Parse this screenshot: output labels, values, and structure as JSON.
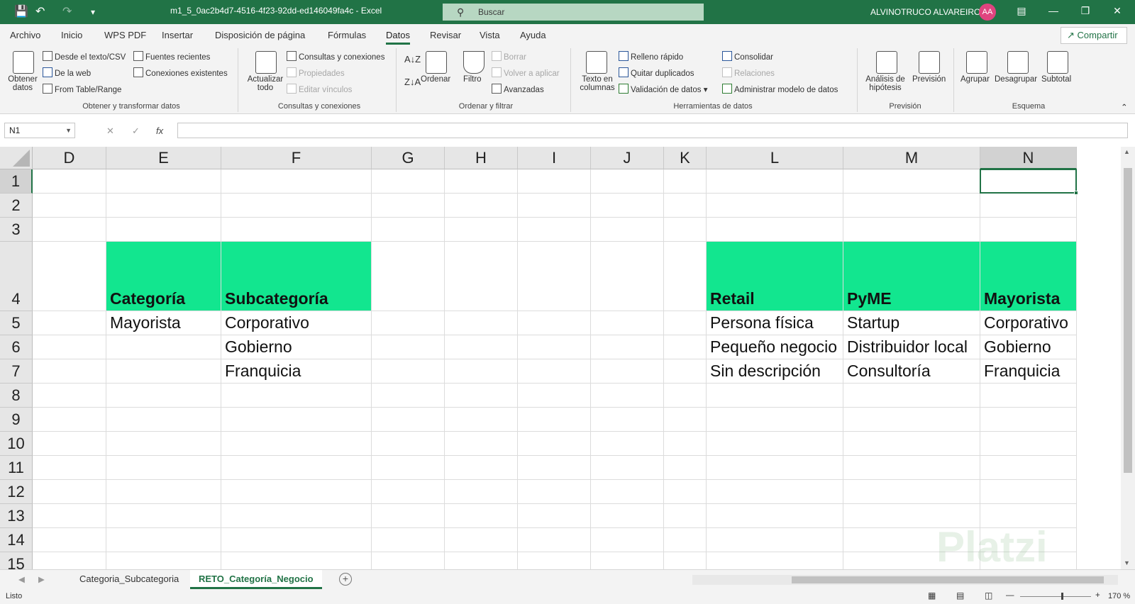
{
  "titlebar": {
    "doc_title": "m1_5_0ac2b4d7-4516-4f23-92dd-ed146049fa4c  -  Excel",
    "search_placeholder": "Buscar",
    "user_name": "ALVINOTRUCO ALVAREIRO",
    "avatar_initials": "AA"
  },
  "tabs": [
    "Archivo",
    "Inicio",
    "WPS PDF",
    "Insertar",
    "Disposición de página",
    "Fórmulas",
    "Datos",
    "Revisar",
    "Vista",
    "Ayuda"
  ],
  "active_tab": "Datos",
  "share_label": "Compartir",
  "ribbon": {
    "get_data": "Obtener datos",
    "from_text": "Desde el texto/CSV",
    "from_web": "De la web",
    "from_table": "From Table/Range",
    "recent_sources": "Fuentes recientes",
    "existing_connections": "Conexiones existentes",
    "group1": "Obtener y transformar datos",
    "refresh_all": "Actualizar todo",
    "queries_connections": "Consultas y conexiones",
    "properties": "Propiedades",
    "edit_links": "Editar vínculos",
    "group2": "Consultas y conexiones",
    "sort": "Ordenar",
    "filter": "Filtro",
    "clear": "Borrar",
    "reapply": "Volver a aplicar",
    "advanced": "Avanzadas",
    "group3": "Ordenar y filtrar",
    "text_to_columns": "Texto en columnas",
    "flash_fill": "Relleno rápido",
    "remove_duplicates": "Quitar duplicados",
    "data_validation": "Validación de datos",
    "consolidate": "Consolidar",
    "relationships": "Relaciones",
    "manage_data_model": "Administrar modelo de datos",
    "group4": "Herramientas de datos",
    "what_if": "Análisis de hipótesis",
    "forecast_sheet": "Previsión",
    "group5": "Previsión",
    "group_btn": "Agrupar",
    "ungroup": "Desagrupar",
    "subtotal": "Subtotal",
    "group6": "Esquema"
  },
  "formula_bar": {
    "name_box": "N1",
    "fx": "fx",
    "formula": ""
  },
  "columns": [
    "D",
    "E",
    "F",
    "G",
    "H",
    "I",
    "J",
    "K",
    "L",
    "M",
    "N"
  ],
  "rows": [
    "1",
    "2",
    "3",
    "4",
    "5",
    "6",
    "7",
    "8",
    "9",
    "10",
    "11",
    "12",
    "13",
    "14",
    "15"
  ],
  "cells": {
    "E4": "Categoría",
    "F4": "Subcategoría",
    "E5": "Mayorista",
    "F5": "Corporativo",
    "F6": "Gobierno",
    "F7": "Franquicia",
    "L4": "Retail",
    "M4": "PyME",
    "N4": "Mayorista",
    "L5": "Persona física",
    "M5": "Startup",
    "N5": "Corporativo",
    "L6": "Pequeño negocio",
    "M6": "Distribuidor local",
    "N6": "Gobierno",
    "L7": "Sin descripción",
    "M7": "Consultoría",
    "N7": "Franquicia"
  },
  "sheets": [
    "Categoria_Subcategoria",
    "RETO_Categoría_Negocio"
  ],
  "active_sheet": "RETO_Categoría_Negocio",
  "status": {
    "ready": "Listo",
    "zoom": "170 %"
  },
  "watermark": "Platzi",
  "colors": {
    "excel_green": "#217346",
    "header_fill": "#12e68f"
  }
}
